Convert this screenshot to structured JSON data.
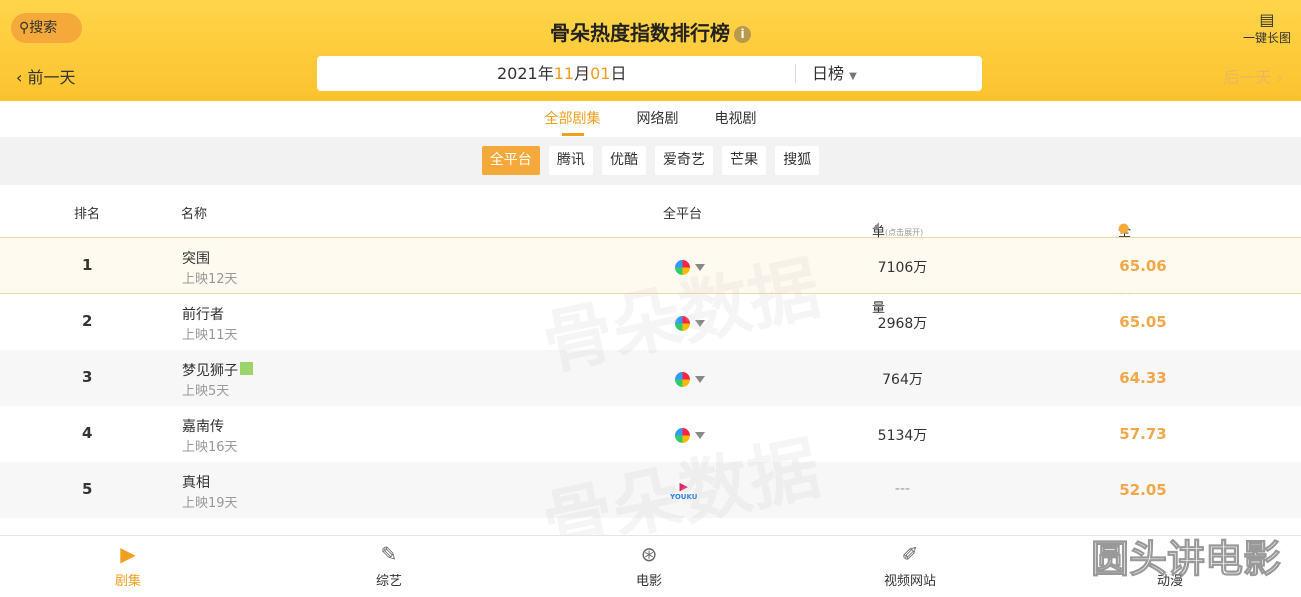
{
  "header": {
    "search": "搜索",
    "title": "骨朵热度指数排行榜",
    "long_image": "一键长图",
    "prev": "前一天",
    "next": "后一天",
    "date_year": "2021年",
    "date_month": "11",
    "date_month_unit": "月",
    "date_day": "01",
    "date_day_unit": "日",
    "period": "日榜"
  },
  "tabs": [
    "全部剧集",
    "网络剧",
    "电视剧"
  ],
  "platforms": [
    "全平台",
    "腾讯",
    "优酷",
    "爱奇艺",
    "芒果",
    "搜狐"
  ],
  "table": {
    "headers": {
      "rank": "排名",
      "name": "名称",
      "platform": "全平台",
      "plays": "单日播放量",
      "plays_sub": "(点击展开)",
      "heat": "全网热度"
    },
    "rows": [
      {
        "rank": "1",
        "name": "突围",
        "days": "上映12天",
        "platform": "multi",
        "plays": "7106万",
        "heat": "65.06"
      },
      {
        "rank": "2",
        "name": "前行者",
        "days": "上映11天",
        "platform": "multi",
        "plays": "2968万",
        "heat": "65.05"
      },
      {
        "rank": "3",
        "name": "梦见狮子",
        "days": "上映5天",
        "platform": "multi",
        "plays": "764万",
        "heat": "64.33"
      },
      {
        "rank": "4",
        "name": "嘉南传",
        "days": "上映16天",
        "platform": "multi",
        "plays": "5134万",
        "heat": "57.73"
      },
      {
        "rank": "5",
        "name": "真相",
        "days": "上映19天",
        "platform": "YOUKU",
        "plays": "---",
        "heat": "52.05"
      }
    ]
  },
  "watermark": "骨朵数据",
  "bottom_nav": [
    "剧集",
    "综艺",
    "电影",
    "视频网站",
    "动漫"
  ],
  "corner_watermark": "圆头讲电影",
  "colors": {
    "accent": "#f0a020",
    "header": "#fcc22e"
  }
}
